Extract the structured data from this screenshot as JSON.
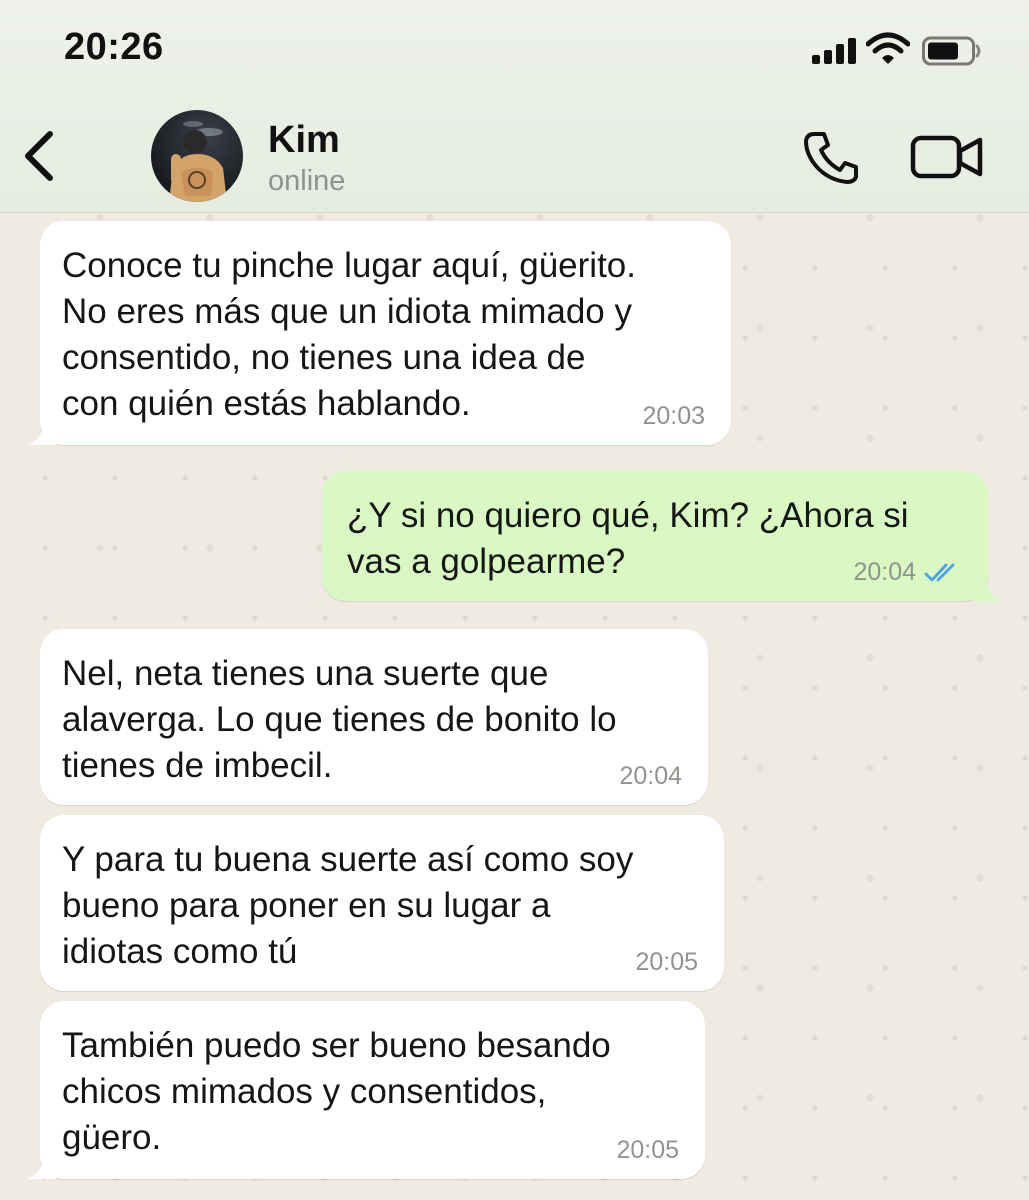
{
  "status_bar": {
    "time": "20:26"
  },
  "header": {
    "contact_name": "Kim",
    "contact_status": "online",
    "icons": {
      "back": "chevron-left-icon",
      "call": "phone-icon",
      "video": "video-camera-icon"
    }
  },
  "colors": {
    "header_bg": "#e9eee5",
    "chat_bg": "#efeae2",
    "incoming_bubble": "#ffffff",
    "outgoing_bubble": "#d9f8c4",
    "read_ticks": "#4fa3e0"
  },
  "messages": [
    {
      "direction": "incoming",
      "text": "Conoce tu pinche lugar aquí, güerito.\nNo eres más que un idiota mimado y\nconsentido, no tienes una idea de\ncon quién estás hablando.",
      "time": "20:03"
    },
    {
      "direction": "outgoing",
      "text": "¿Y si no quiero qué, Kim? ¿Ahora si\nvas a golpearme?",
      "time": "20:04",
      "read": true
    },
    {
      "direction": "incoming",
      "text": "Nel, neta tienes una suerte que\nalaverga. Lo que tienes de bonito lo\ntienes de imbecil.",
      "time": "20:04"
    },
    {
      "direction": "incoming",
      "text": "Y para tu buena suerte así como soy\nbueno para poner en su lugar a\nidiotas como tú",
      "time": "20:05"
    },
    {
      "direction": "incoming",
      "text": "También puedo ser bueno besando\nchicos mimados y consentidos,\ngüero.",
      "time": "20:05"
    }
  ]
}
